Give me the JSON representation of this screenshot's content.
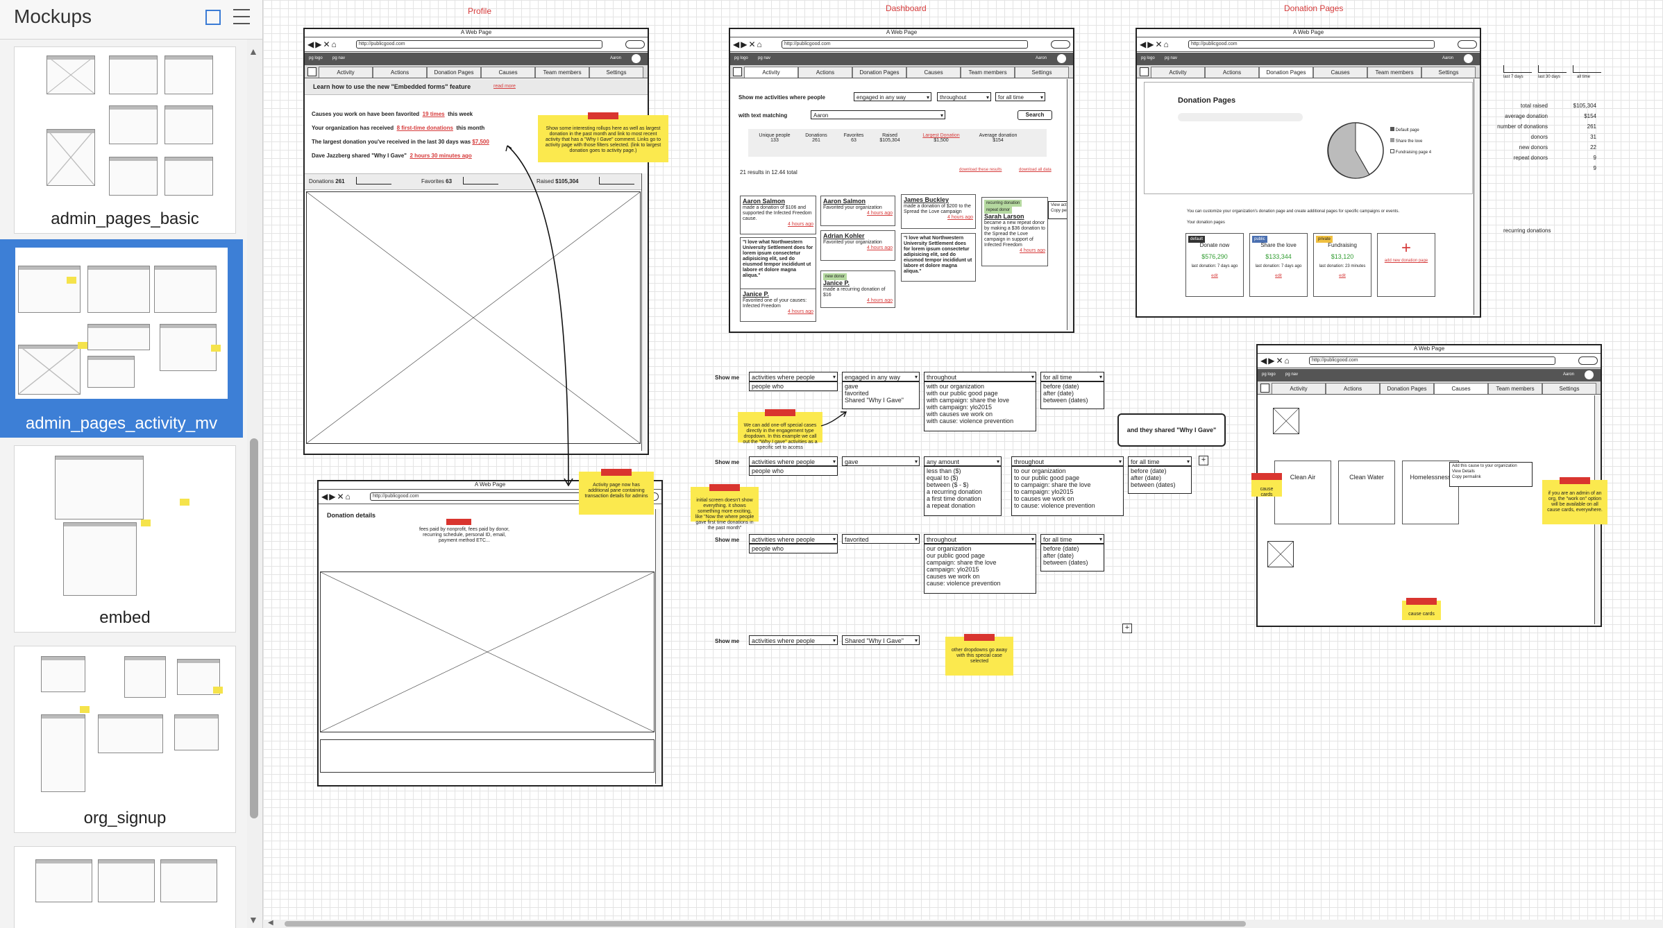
{
  "sidebar": {
    "title": "Mockups",
    "items": [
      {
        "label": "admin_pages_basic"
      },
      {
        "label": "admin_pages_activity_mv"
      },
      {
        "label": "embed"
      },
      {
        "label": "org_signup"
      }
    ]
  },
  "sections": {
    "profile": "Profile",
    "dashboard": "Dashboard",
    "donation_pages": "Donation Pages"
  },
  "browser": {
    "title": "A Web Page",
    "url": "http://publicgood.com"
  },
  "app": {
    "logo": "pg logo",
    "nav": "pg nav",
    "user": "Aaron"
  },
  "tabs": [
    "Activity",
    "Actions",
    "Donation Pages",
    "Causes",
    "Team members",
    "Settings"
  ],
  "profile": {
    "banner": "Learn how to use the new \"Embedded forms\" feature",
    "banner_link": "read more",
    "line1_a": "Causes you work on have been favorited",
    "line1_link": "19 times",
    "line1_b": "this week",
    "line2_a": "Your organization has received",
    "line2_link": "8 first-time donations",
    "line2_b": "this month",
    "line3_a": "The largest donation you've received in the last 30 days was",
    "line3_link": "$7,500",
    "line4_a": "Dave Jazzberg shared \"Why I Gave\"",
    "line4_link": "2 hours 30 minutes ago",
    "note1": "Show some interesting rollups here as well as largest donation in the past month and link to most recent activity that has a \"Why I Gave\" comment. Links go to activity page with those filters selected. (link to largest donation goes to activity page.)",
    "stat_donations_label": "Donations",
    "stat_donations": "261",
    "stat_favorites_label": "Favorites",
    "stat_favorites": "63",
    "stat_raised_label": "Raised",
    "stat_raised": "$105,304"
  },
  "donation_details": {
    "title": "Donation details",
    "text": "fees paid by nonprofit, fees paid by donor, recurring schedule, personal ID, email, payment method ETC...",
    "note": "Activity page now has additional pane containing transaction details for admins"
  },
  "dashboard": {
    "show_me": "Show me activities where people",
    "dd1": "engaged in any way",
    "dd2": "throughout",
    "dd3": "for all time",
    "text_matching": "with text matching",
    "search_value": "Aaron",
    "search_btn": "Search",
    "stats": [
      {
        "label": "Unique people",
        "value": "133"
      },
      {
        "label": "Donations",
        "value": "261"
      },
      {
        "label": "Favorites",
        "value": "63"
      },
      {
        "label": "Raised",
        "value": "$105,304"
      },
      {
        "label": "Largest Donation",
        "value": "$1,500"
      },
      {
        "label": "Average donation",
        "value": "$154"
      }
    ],
    "results": "21 results in 12.44 total",
    "download_results": "download these results",
    "download_all": "download all data",
    "cards": [
      {
        "name": "Aaron Salmon",
        "text": "made a donation of $106 and supported the Infected Freedom cause.",
        "time": "4 hours ago"
      },
      {
        "name": "Aaron Salmon",
        "text": "Favorited your organization",
        "time": "4 hours ago"
      },
      {
        "name": "James Buckley",
        "text": "made a donation of $200 to the Spread the Love campaign",
        "time": "4 hours ago"
      },
      {
        "name": "Sarah Larson",
        "text": "became a new repeat donor by making a $36 donation to the Spread the Love campaign in support of Infected Freedom",
        "time": "4 hours ago"
      },
      {
        "name": "Adrian Kohler",
        "text": "Favorited your organization",
        "time": "4 hours ago"
      },
      {
        "name": "Janice P.",
        "text": "Favorited one of your causes: Infected Freedom",
        "time": "4 hours ago"
      },
      {
        "name": "Janice P.",
        "text": "made a recurring donation of $16",
        "time": "4 hours ago"
      }
    ],
    "quote": "\"I love what Northwestern University Settlement does for lorem ipsum consectetur adipisicing elit, sed do eiusmod tempor incididunt ut labore et dolore magna aliqua.\"",
    "tag_new": "new donor",
    "tag_recurring": "recurring donation",
    "tag_repeat": "repeat donor",
    "menu": [
      "View activity details",
      "Copy permalink"
    ]
  },
  "filters": {
    "show_me": "Show me",
    "activities": "activities where people",
    "people_who": "people who",
    "row1_c2": "engaged in any way",
    "row1_c2_opts": "gave\nfavorited\nShared \"Why I Gave\"",
    "throughout": "throughout",
    "row1_c3_opts": "with our organization\nwith our public good page\nwith campaign: share the love\nwith campaign: ylo2015\nwith causes we work on\nwith cause: violence prevention",
    "for_all_time": "for all time",
    "time_opts": "before (date)\nafter (date)\nbetween (dates)",
    "bubble": "and they shared \"Why I Gave\"",
    "note_a": "We can add one-off special cases directly in the engagement type dropdown. In this example we call out the \"Why I gave\" activities as a specific set to access",
    "note_b": "initial screen doesn't show everything. it shows something more exciting, like \"Now the where people gave first time donations in the past month\"",
    "row2_c2": "gave",
    "row2_c3": "any amount",
    "row2_c3_opts": "less than ($)\nequal to ($)\nbetween ($ - $)\na recurring donation\na first time donation\na repeat donation",
    "row2_c4_opts": "to our organization\nto our public good page\nto campaign: share the love\nto campaign: ylo2015\nto causes we work on\nto cause: violence prevention",
    "row3_c2": "favorited",
    "row3_c3_opts": "our organization\nour public good page\ncampaign: share the love\ncampaign: ylo2015\ncauses we work on\ncause: violence prevention",
    "row4_c2": "Shared \"Why I Gave\"",
    "note_c": "other dropdowns go away with this special case selected"
  },
  "donation_pages": {
    "title": "Donation Pages",
    "legend": [
      "Default page",
      "Share the love",
      "Fundraising page 4"
    ],
    "desc": "You can customize your organization's donation page and create additional pages for specific campaigns or events.",
    "your_pages": "Your donation pages",
    "pages": [
      {
        "tag": "default",
        "name": "Donate now",
        "amount": "$576,290",
        "last": "last donation: 7 days ago",
        "edit": "edit"
      },
      {
        "tag": "public",
        "name": "Share the love",
        "amount": "$133,344",
        "last": "last donation: 7 days ago",
        "edit": "edit"
      },
      {
        "tag": "private",
        "name": "Fundraising",
        "amount": "$13,120",
        "last": "last donation: 23 minutes",
        "edit": "edit"
      }
    ],
    "add_new": "add new donation page"
  },
  "metrics": {
    "spark_labels": [
      "last 7 days",
      "last 30 days",
      "all time"
    ],
    "rows": [
      {
        "label": "total raised",
        "value": "$105,304"
      },
      {
        "label": "average donation",
        "value": "$154"
      },
      {
        "label": "number of donations",
        "value": "261"
      },
      {
        "label": "donors",
        "value": "31"
      },
      {
        "label": "new donors",
        "value": "22"
      },
      {
        "label": "repeat donors",
        "value": "9"
      },
      {
        "label": "",
        "value": "9"
      }
    ],
    "recurring": "recurring donations"
  },
  "causes": {
    "cards": [
      {
        "name": "Clean Air"
      },
      {
        "name": "Clean Water"
      },
      {
        "name": "Homelessness"
      }
    ],
    "menu": [
      "Add this cause to your organization",
      "View Details",
      "Copy permalink"
    ],
    "note_left": "cause cards",
    "note_bottom": "cause cards",
    "note_right": "if you are an admin of an org, the \"work on\" option will be available on all cause cards, everywhere."
  },
  "colors": {
    "accent": "#3d7fd6",
    "sticky": "#fbe94e",
    "sticky_tab": "#d9352f",
    "link_red": "#d63a3a"
  }
}
